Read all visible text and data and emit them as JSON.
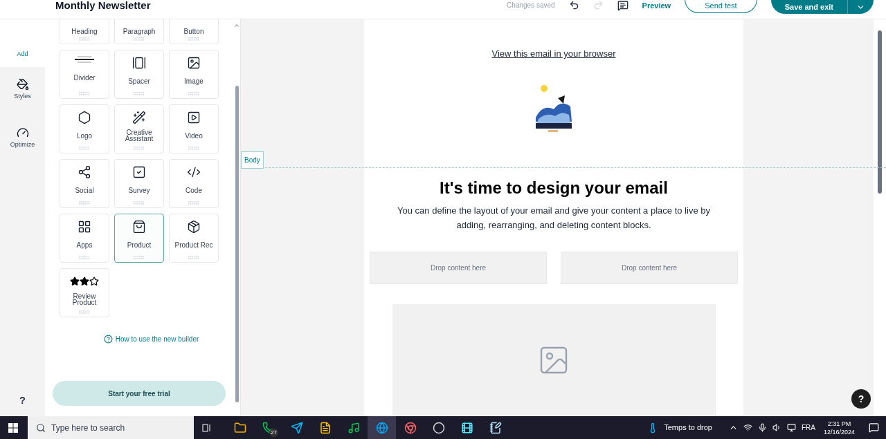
{
  "header": {
    "title": "Monthly Newsletter",
    "status": "Changes saved",
    "redo_disabled": true,
    "preview": "Preview",
    "send_test": "Send test",
    "save": "Save and exit"
  },
  "rail": {
    "items": [
      {
        "label": "Add",
        "selected": true
      },
      {
        "label": "Styles",
        "selected": false
      },
      {
        "label": "Optimize",
        "selected": false
      }
    ],
    "help": "?"
  },
  "blocks": [
    {
      "label": "Heading",
      "selected": false
    },
    {
      "label": "Paragraph",
      "selected": false
    },
    {
      "label": "Button",
      "selected": false
    },
    {
      "label": "Divider",
      "selected": false
    },
    {
      "label": "Spacer",
      "selected": false
    },
    {
      "label": "Image",
      "selected": false
    },
    {
      "label": "Logo",
      "selected": false
    },
    {
      "label": "Creative Assistant",
      "selected": false
    },
    {
      "label": "Video",
      "selected": false
    },
    {
      "label": "Social",
      "selected": false
    },
    {
      "label": "Survey",
      "selected": false
    },
    {
      "label": "Code",
      "selected": false
    },
    {
      "label": "Apps",
      "selected": false
    },
    {
      "label": "Product",
      "selected": true
    },
    {
      "label": "Product Rec",
      "selected": false
    },
    {
      "label": "Review Product",
      "selected": false
    }
  ],
  "help_link": "How to use the new builder",
  "trial_button": "Start your free trial",
  "email": {
    "view_in_browser": "View this email in your browser",
    "section_tag": "Body",
    "heading": "It's time to design your email",
    "body": "You can define the layout of your email and give your content a place to live by adding, rearranging, and deleting content blocks.",
    "drop_zones": [
      "Drop content here",
      "Drop content here"
    ]
  },
  "help_button": "?",
  "taskbar": {
    "search_placeholder": "Type here to search",
    "apps": [
      {
        "selected": false
      },
      {
        "selected": false,
        "badge": "27"
      },
      {
        "selected": false
      },
      {
        "selected": false
      },
      {
        "selected": false
      },
      {
        "selected": true
      },
      {
        "selected": false
      },
      {
        "selected": false
      },
      {
        "selected": false
      },
      {
        "selected": false
      }
    ],
    "weather": "Temps to drop",
    "language": "FRA",
    "time": "2:31 PM",
    "date": "12/16/2024"
  }
}
